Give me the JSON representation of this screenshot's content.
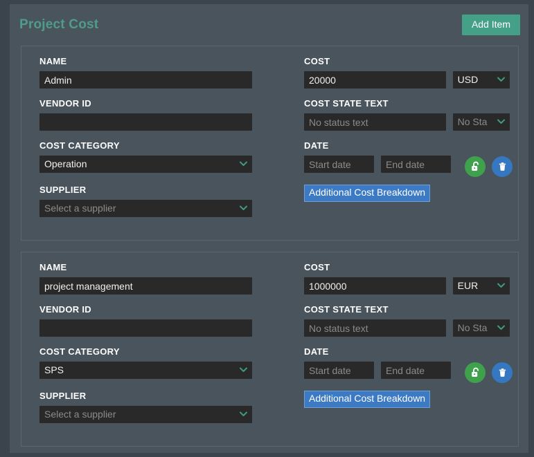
{
  "header": {
    "title": "Project Cost",
    "add_item_label": "Add Item"
  },
  "labels": {
    "name": "NAME",
    "vendor_id": "VENDOR ID",
    "cost_category": "COST CATEGORY",
    "supplier": "SUPPLIER",
    "cost": "COST",
    "cost_state_text": "COST STATE TEXT",
    "date": "DATE"
  },
  "placeholders": {
    "name": "",
    "vendor_id": "",
    "cost": "",
    "cost_state_text": "No status text",
    "start_date": "Start date",
    "end_date": "End date",
    "supplier": "Select a supplier"
  },
  "icons": {
    "chevron_down": "chevron-down-icon",
    "unlock": "unlock-icon",
    "delete": "trash-icon"
  },
  "colors": {
    "page_background": "#3b444c",
    "panel_background": "#4a545d",
    "card_border": "#596570",
    "input_background": "#292929",
    "title_teal": "#4e9c89",
    "accent_teal": "#44a188",
    "chevron_teal": "#3f9a81",
    "unlock_green": "#3fa14b",
    "delete_blue": "#3577c0",
    "link_blue": "#3c7ac4",
    "placeholder_text": "#8b8b8b"
  },
  "breakdown_label": "Additional Cost Breakdown",
  "cards": [
    {
      "name": "Admin",
      "vendor_id": "",
      "cost_category": "Operation",
      "supplier": "Select a supplier",
      "supplier_is_placeholder": true,
      "cost": "20000",
      "currency": "USD",
      "cost_state_text": "",
      "cost_state": "No Sta",
      "start_date": "",
      "end_date": "",
      "breakdown_label": "Additional Cost Breakdown"
    },
    {
      "name": "project management",
      "vendor_id": "",
      "cost_category": "SPS",
      "supplier": "Select a supplier",
      "supplier_is_placeholder": true,
      "cost": "1000000",
      "currency": "EUR",
      "cost_state_text": "",
      "cost_state": "No Sta",
      "start_date": "",
      "end_date": "",
      "breakdown_label": "Additional Cost Breakdown"
    }
  ]
}
